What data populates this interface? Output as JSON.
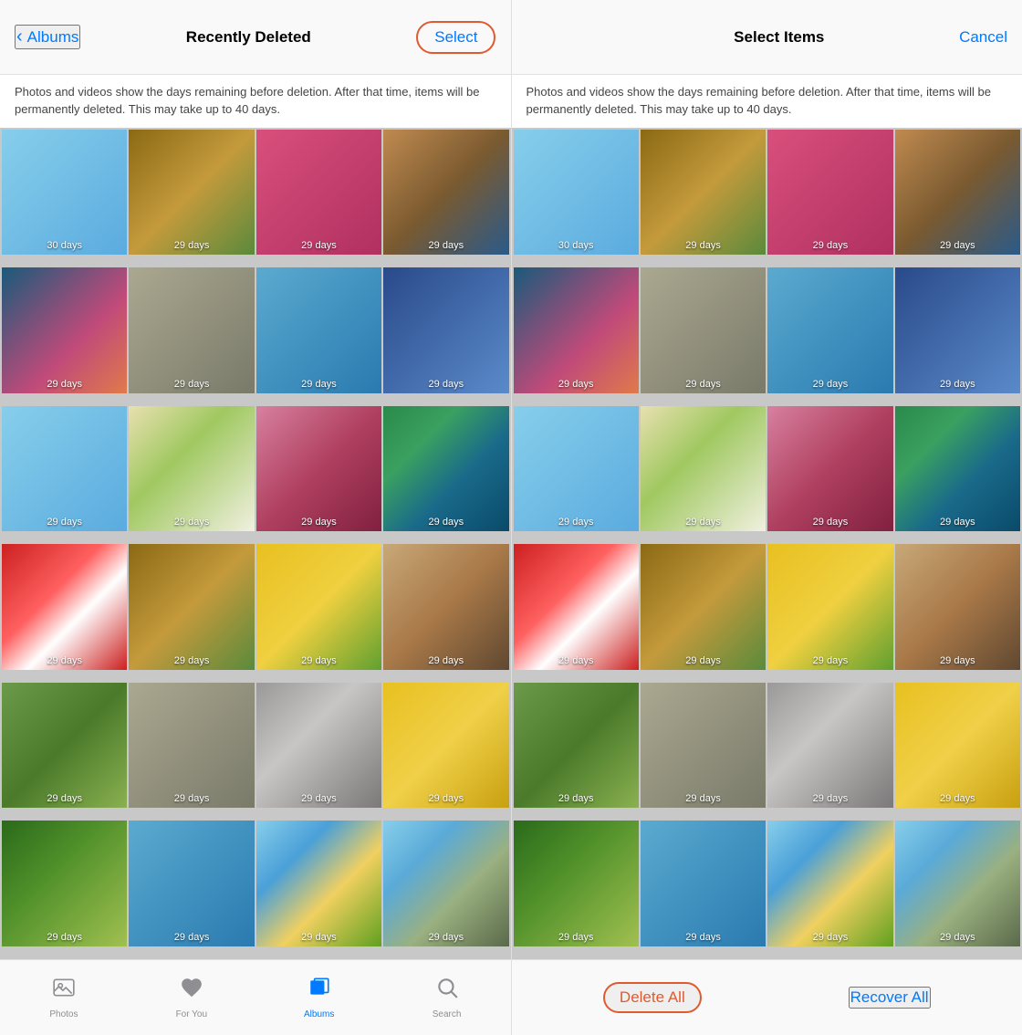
{
  "left_panel": {
    "header": {
      "back_label": "Albums",
      "title": "Recently Deleted",
      "select_label": "Select"
    },
    "description": "Photos and videos show the days remaining before deletion. After that time, items will be permanently deleted. This may take up to 40 days.",
    "photos": [
      {
        "days": "30 days",
        "type": "type-a"
      },
      {
        "days": "29 days",
        "type": "type-b"
      },
      {
        "days": "29 days",
        "type": "type-c"
      },
      {
        "days": "29 days",
        "type": "type-d"
      },
      {
        "days": "29 days",
        "type": "type-e"
      },
      {
        "days": "29 days",
        "type": "type-f"
      },
      {
        "days": "29 days",
        "type": "type-g"
      },
      {
        "days": "29 days",
        "type": "type-h"
      },
      {
        "days": "29 days",
        "type": "type-a"
      },
      {
        "days": "29 days",
        "type": "type-tulip"
      },
      {
        "days": "29 days",
        "type": "type-pink-flower"
      },
      {
        "days": "29 days",
        "type": "type-peacock"
      },
      {
        "days": "29 days",
        "type": "type-red-white"
      },
      {
        "days": "29 days",
        "type": "type-b"
      },
      {
        "days": "29 days",
        "type": "type-yellow-flower"
      },
      {
        "days": "29 days",
        "type": "type-coffee"
      },
      {
        "days": "29 days",
        "type": "type-grass"
      },
      {
        "days": "29 days",
        "type": "type-f"
      },
      {
        "days": "29 days",
        "type": "type-stones"
      },
      {
        "days": "29 days",
        "type": "type-yellow-fruit"
      },
      {
        "days": "29 days",
        "type": "type-salad"
      },
      {
        "days": "29 days",
        "type": "type-g"
      },
      {
        "days": "29 days",
        "type": "type-sky-field"
      },
      {
        "days": "29 days",
        "type": "type-road"
      }
    ],
    "tabs": [
      {
        "label": "Photos",
        "icon": "photos-icon",
        "active": false
      },
      {
        "label": "For You",
        "icon": "for-you-icon",
        "active": false
      },
      {
        "label": "Albums",
        "icon": "albums-icon",
        "active": true
      },
      {
        "label": "Search",
        "icon": "search-icon",
        "active": false
      }
    ]
  },
  "right_panel": {
    "header": {
      "title": "Select Items",
      "cancel_label": "Cancel"
    },
    "description": "Photos and videos show the days remaining before deletion. After that time, items will be permanently deleted. This may take up to 40 days.",
    "photos": [
      {
        "days": "30 days",
        "type": "type-a"
      },
      {
        "days": "29 days",
        "type": "type-b"
      },
      {
        "days": "29 days",
        "type": "type-c"
      },
      {
        "days": "29 days",
        "type": "type-d"
      },
      {
        "days": "29 days",
        "type": "type-e"
      },
      {
        "days": "29 days",
        "type": "type-f"
      },
      {
        "days": "29 days",
        "type": "type-g"
      },
      {
        "days": "29 days",
        "type": "type-h"
      },
      {
        "days": "29 days",
        "type": "type-a"
      },
      {
        "days": "29 days",
        "type": "type-tulip"
      },
      {
        "days": "29 days",
        "type": "type-pink-flower"
      },
      {
        "days": "29 days",
        "type": "type-peacock"
      },
      {
        "days": "29 days",
        "type": "type-red-white"
      },
      {
        "days": "29 days",
        "type": "type-b"
      },
      {
        "days": "29 days",
        "type": "type-yellow-flower"
      },
      {
        "days": "29 days",
        "type": "type-coffee"
      },
      {
        "days": "29 days",
        "type": "type-grass"
      },
      {
        "days": "29 days",
        "type": "type-f"
      },
      {
        "days": "29 days",
        "type": "type-stones"
      },
      {
        "days": "29 days",
        "type": "type-yellow-fruit"
      },
      {
        "days": "29 days",
        "type": "type-salad"
      },
      {
        "days": "29 days",
        "type": "type-g"
      },
      {
        "days": "29 days",
        "type": "type-sky-field"
      },
      {
        "days": "29 days",
        "type": "type-road"
      }
    ],
    "bottom_actions": {
      "delete_all_label": "Delete All",
      "recover_all_label": "Recover All"
    }
  }
}
